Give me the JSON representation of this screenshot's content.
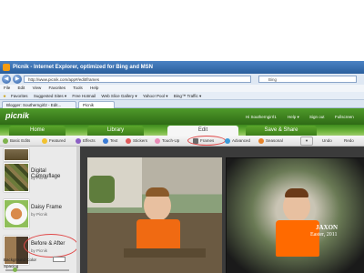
{
  "window": {
    "title": "Picnik - Internet Explorer, optimized for Bing and MSN",
    "min_label": "–",
    "max_label": "□",
    "close_label": "✕"
  },
  "browser": {
    "back_label": "◀",
    "forward_label": "▶",
    "address": "http://www.picnik.com/app#/edit/frames",
    "search_placeholder": "Bing",
    "menu": [
      "File",
      "Edit",
      "View",
      "Favorites",
      "Tools",
      "Help"
    ],
    "favorites": [
      "Favorites",
      "Suggested Sites ▾",
      "Free Hotmail",
      "Web Slice Gallery ▾",
      "Yahoo! Pool ▾",
      "Bing™ Traffic ▾"
    ],
    "tabs": [
      "Blogger: Southerngirl2 - Edit...",
      "Picnik"
    ]
  },
  "picnik": {
    "logo": "picnik",
    "user": "Hi Southerngirrl1",
    "help": "Help ▾",
    "sign_out": "Sign out",
    "fullscreen": "Fullscreen",
    "main_tabs": [
      "Home",
      "Library",
      "Edit",
      "Save & Share"
    ],
    "tools": [
      "Basic Edits",
      "Featured",
      "Effects",
      "Text",
      "Stickers",
      "Touch-Up",
      "Frames",
      "Advanced",
      "Seasonal"
    ],
    "undo": "Undo",
    "redo": "Redo"
  },
  "left_panel": {
    "items": [
      {
        "name": "",
        "by": ""
      },
      {
        "name": "Digital Camouflage",
        "by": "by Picnik"
      },
      {
        "name": "Daisy Frame",
        "by": "by Picnik"
      },
      {
        "name": "Before & After",
        "by": "by Picnik"
      }
    ],
    "bg_color_label": "Background Color",
    "spacing_label": "Spacing"
  },
  "canvas": {
    "after_caption_1": "JAXON",
    "after_caption_2": "Easter, 2011"
  },
  "colors": {
    "accent_green": "#3d7f1a",
    "annotation_red": "#e04848"
  }
}
